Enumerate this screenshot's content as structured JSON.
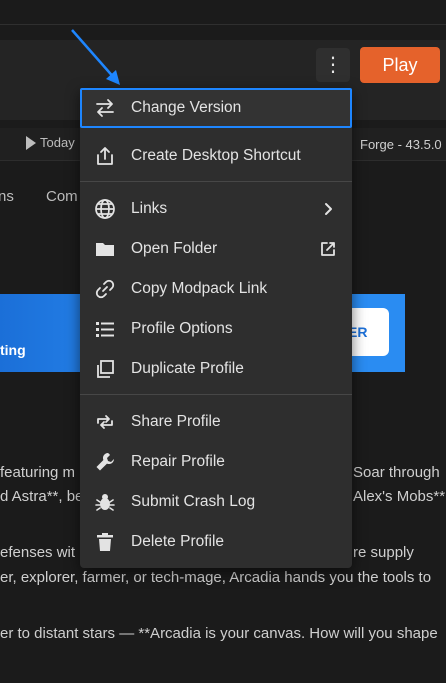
{
  "header": {
    "play_label": "Play",
    "more_label": "⋮"
  },
  "info": {
    "today_label": "Today",
    "forge_label": "Forge - 43.5.0"
  },
  "tabs": {
    "partial_1": "ns",
    "partial_2": "Com"
  },
  "banner": {
    "text": "ting",
    "button_label": "ER"
  },
  "body_lines": [
    "featuring m",
    "d Astra**, be",
    "efenses wit",
    "er, explorer, farmer, or tech-mage, Arcadia hands you the tools to",
    "er to distant stars — **Arcadia is your canvas. How will you shape"
  ],
  "body_right": [
    "Soar through",
    "Alex's Mobs**,",
    "re supply"
  ],
  "menu": {
    "items": [
      {
        "label": "Change Version",
        "icon": "swap-arrows-icon"
      },
      {
        "label": "Create Desktop Shortcut",
        "icon": "share-upload-icon"
      },
      {
        "label": "Links",
        "icon": "globe-icon",
        "trailing": "chevron-right-icon"
      },
      {
        "label": "Open Folder",
        "icon": "folder-icon",
        "trailing": "external-link-icon"
      },
      {
        "label": "Copy Modpack Link",
        "icon": "link-icon"
      },
      {
        "label": "Profile Options",
        "icon": "list-icon"
      },
      {
        "label": "Duplicate Profile",
        "icon": "copy-icon"
      },
      {
        "label": "Share Profile",
        "icon": "share-arrows-icon"
      },
      {
        "label": "Repair Profile",
        "icon": "wrench-icon"
      },
      {
        "label": "Submit Crash Log",
        "icon": "bug-icon"
      },
      {
        "label": "Delete Profile",
        "icon": "trash-icon"
      }
    ]
  },
  "colors": {
    "accent": "#1e86ff",
    "play": "#e5622b",
    "menu_bg": "#2e2e2e",
    "page_bg": "#1b1b1b"
  }
}
